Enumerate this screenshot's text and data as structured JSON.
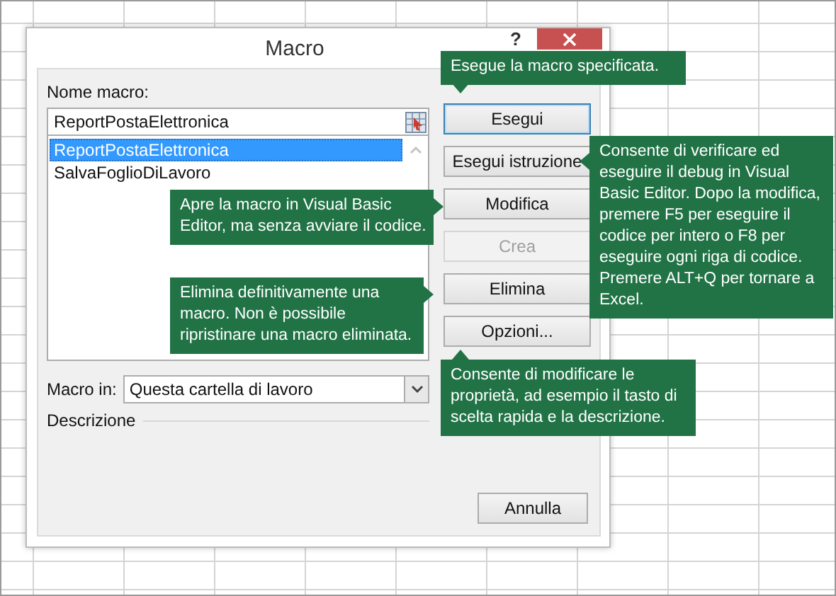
{
  "window": {
    "title": "Macro",
    "help_label": "?"
  },
  "macro_name": {
    "label": "Nome macro:",
    "value": "ReportPostaElettronica"
  },
  "macro_list": [
    {
      "name": "ReportPostaElettronica",
      "selected": true
    },
    {
      "name": "SalvaFoglioDiLavoro",
      "selected": false
    }
  ],
  "buttons": [
    {
      "label": "Esegui",
      "disabled": false,
      "focused": true
    },
    {
      "label": "Esegui istruzione",
      "disabled": false,
      "focused": false
    },
    {
      "label": "Modifica",
      "disabled": false,
      "focused": false
    },
    {
      "label": "Crea",
      "disabled": true,
      "focused": false
    },
    {
      "label": "Elimina",
      "disabled": false,
      "focused": false
    },
    {
      "label": "Opzioni...",
      "disabled": false,
      "focused": false
    }
  ],
  "macro_in": {
    "label": "Macro in:",
    "value": "Questa cartella di lavoro"
  },
  "description": {
    "label": "Descrizione"
  },
  "cancel_button": "Annulla",
  "callouts": [
    {
      "text": "Esegue la macro specificata.",
      "kind": "pointer-down"
    },
    {
      "text": "Consente di verificare ed eseguire il debug in Visual Basic Editor. Dopo la modifica, premere F5 per eseguire il codice per intero o F8 per eseguire ogni riga di codice.\nPremere ALT+Q per tornare a Excel.",
      "kind": "pointer-left"
    },
    {
      "text": "Apre la macro in Visual Basic Editor, ma senza avviare il codice.",
      "kind": "pointer-right"
    },
    {
      "text": "Elimina definitivamente una macro. Non è possibile ripristinare una macro eliminata.",
      "kind": "pointer-right"
    },
    {
      "text": "Consente di modificare le proprietà, ad esempio il tasto di scelta rapida e la descrizione.",
      "kind": "pointer-up"
    }
  ]
}
